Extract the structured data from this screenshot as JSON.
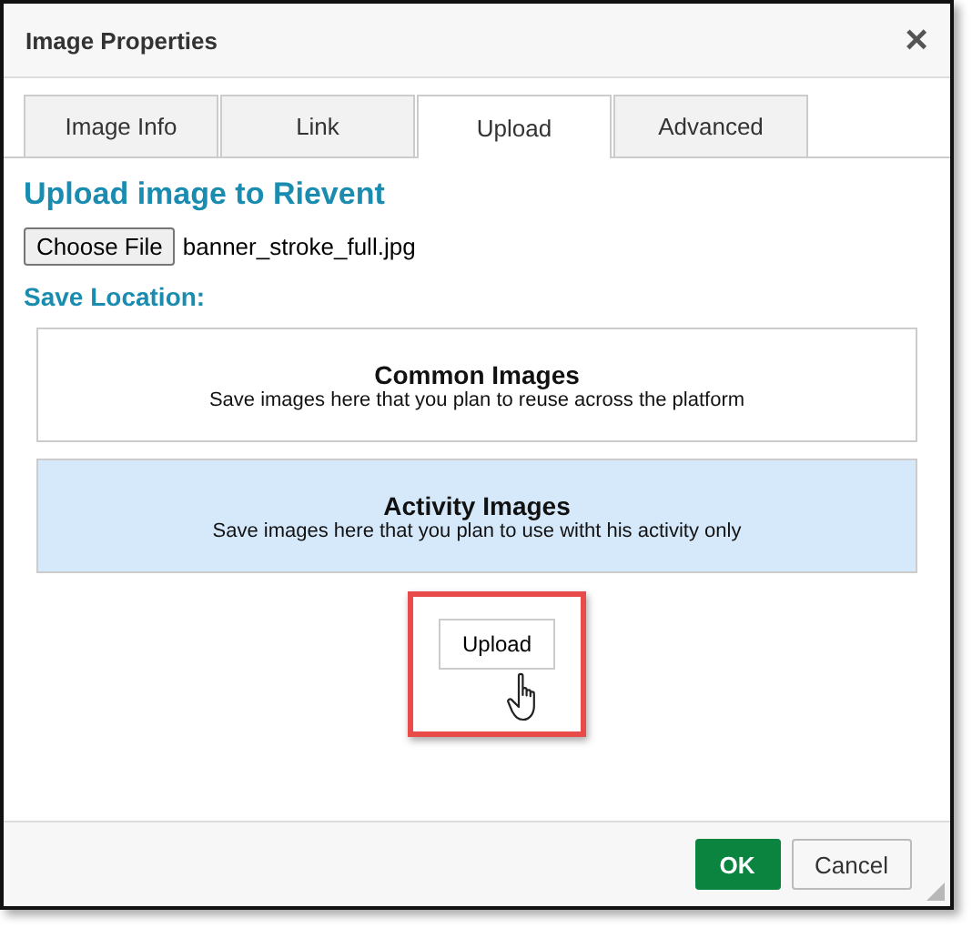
{
  "window": {
    "title": "Image Properties",
    "close": "×"
  },
  "tabs": [
    {
      "label": "Image Info",
      "selected": false
    },
    {
      "label": "Link",
      "selected": false
    },
    {
      "label": "Upload",
      "selected": true
    },
    {
      "label": "Advanced",
      "selected": false
    }
  ],
  "heading": "Upload image to Rievent",
  "file": {
    "button": "Choose File",
    "value": "banner_stroke_full.jpg"
  },
  "save_location": {
    "label": "Save Location:",
    "options": [
      {
        "title": "Common Images",
        "description": "Save images here that you plan to reuse across the platform",
        "selected": false
      },
      {
        "title": "Activity Images",
        "description": "Save images here that you plan to use witht his activity only",
        "selected": true
      }
    ]
  },
  "upload_button": "Upload",
  "buttons": [
    {
      "label": "OK",
      "kind": "primary"
    },
    {
      "label": "Cancel",
      "kind": "secondary"
    }
  ]
}
